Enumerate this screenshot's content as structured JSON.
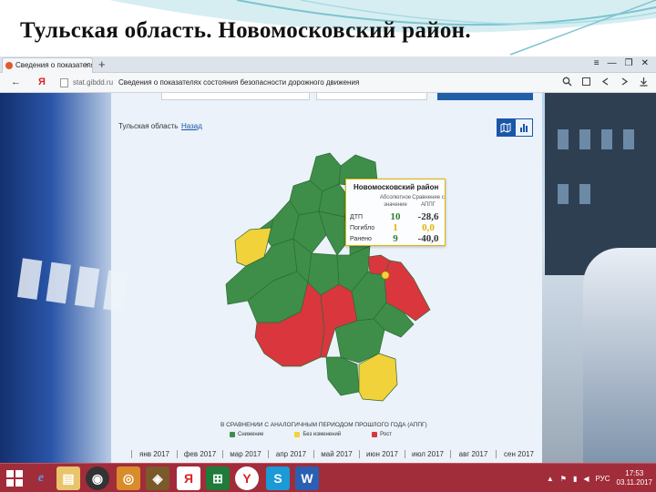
{
  "slide": {
    "title": "Тульская область.  Новомосковский район."
  },
  "browser": {
    "tab_title": "Сведения о показателях",
    "tab_close": "×",
    "new_tab": "+",
    "window_controls": [
      "≡",
      "—",
      "❐",
      "✕"
    ],
    "back": "←",
    "yandex": "Я",
    "url_domain": "stat.gibdd.ru",
    "url_title": "Сведения о показателях состояния безопасности дорожного движения"
  },
  "page": {
    "region_label": "Тульская область",
    "back_link": "Назад",
    "view_toggle": {
      "map_icon": "map-icon",
      "chart_icon": "bar-chart-icon",
      "active": "map"
    },
    "tooltip": {
      "district": "Новомосковский район",
      "col_abs": "Абсолютное значение",
      "col_cmp": "Сравнение с АППГ",
      "rows": [
        {
          "label": "ДТП",
          "abs": "10",
          "cmp": "-28,6",
          "abs_color": "#2e7d32"
        },
        {
          "label": "Погибло",
          "abs": "1",
          "cmp": "0,0",
          "abs_color": "#e3b400"
        },
        {
          "label": "Ранено",
          "abs": "9",
          "cmp": "-40,0",
          "abs_color": "#2e7d32"
        }
      ]
    },
    "legend_title": "В СРАВНЕНИИ С АНАЛОГИЧНЫМ ПЕРИОДОМ ПРОШЛОГО ГОДА (АППГ)",
    "legend": [
      {
        "label": "Снижение",
        "color": "#3e8e4a"
      },
      {
        "label": "Без изменений",
        "color": "#f1d23a"
      },
      {
        "label": "Рост",
        "color": "#d9363e"
      }
    ],
    "months": [
      "янв 2017",
      "фев 2017",
      "мар 2017",
      "апр 2017",
      "май 2017",
      "июн 2017",
      "июл 2017",
      "авг 2017",
      "сен 2017"
    ],
    "map_colors": {
      "green": "#3e8e4a",
      "red": "#d9363e",
      "yellow": "#f1d23a"
    }
  },
  "taskbar": {
    "icons": [
      "ie-icon",
      "explorer-icon",
      "media-icon",
      "app-icon",
      "app2-icon",
      "yandex-app-icon",
      "excel-icon",
      "yandex-browser-icon",
      "skype-icon",
      "word-icon"
    ],
    "lang": "РУС",
    "time": "17:53",
    "date": "03.11.2017"
  }
}
